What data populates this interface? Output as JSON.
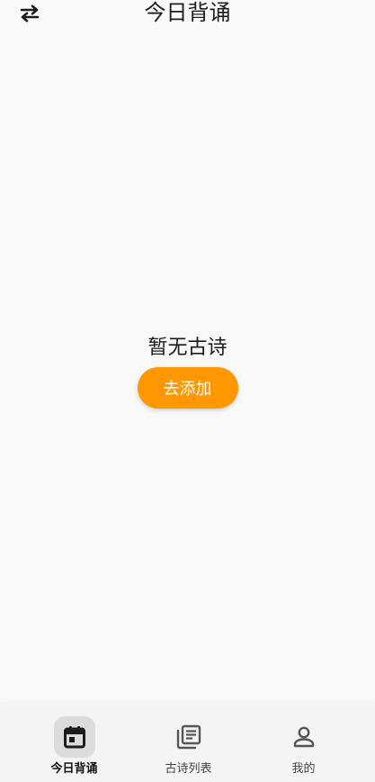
{
  "header": {
    "title": "今日背诵",
    "swap_icon": "swap-arrows-icon"
  },
  "empty_state": {
    "message": "暂无古诗",
    "add_button": "去添加"
  },
  "colors": {
    "accent": "#ff9800",
    "background": "#f9f9f9",
    "nav_active_bg": "#dcdcdc"
  },
  "bottom_nav": {
    "items": [
      {
        "label": "今日背诵",
        "icon": "calendar-icon",
        "active": true
      },
      {
        "label": "古诗列表",
        "icon": "list-icon",
        "active": false
      },
      {
        "label": "我的",
        "icon": "person-icon",
        "active": false
      }
    ]
  }
}
